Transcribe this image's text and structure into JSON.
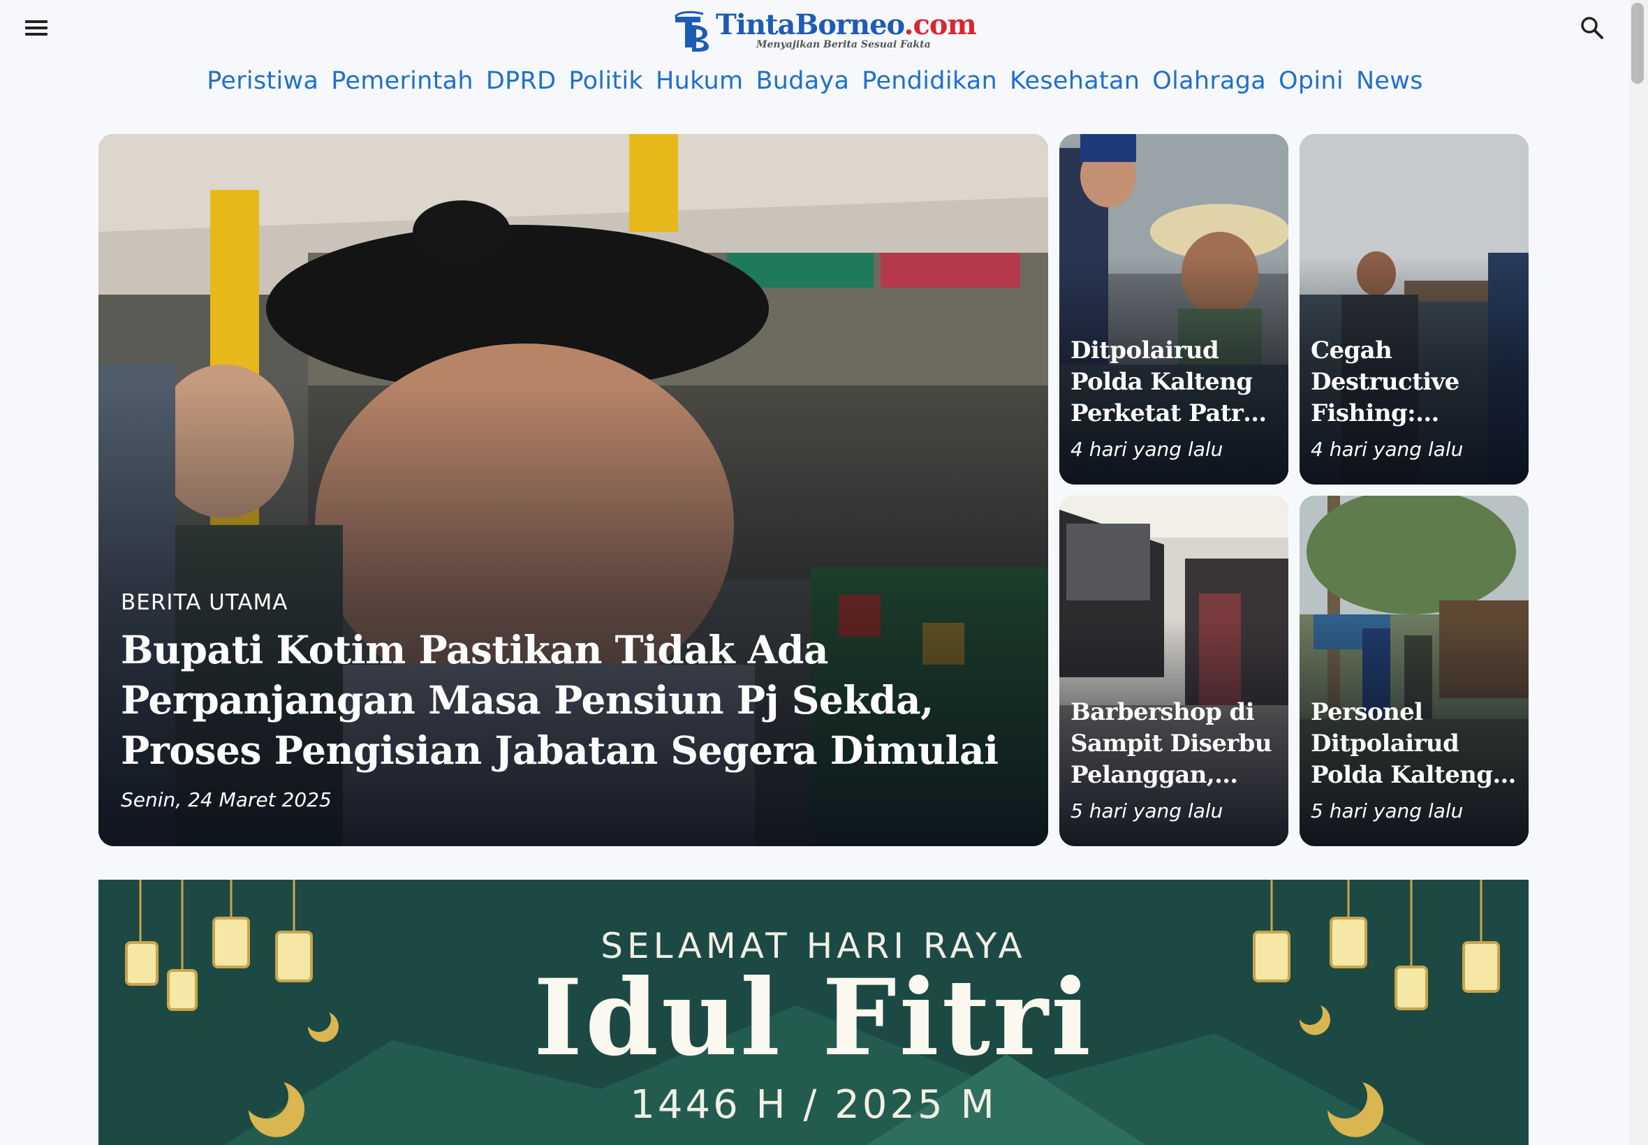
{
  "site": {
    "name": "TintaBorneo",
    "domain": ".com",
    "tagline": "Menyajikan Berita Sesuai Fakta"
  },
  "icons": {
    "menu": "hamburger-menu-icon",
    "search": "search-icon"
  },
  "colors": {
    "brand_blue": "#1e5bb5",
    "nav_blue": "#1e6fd0",
    "brand_red": "#d8282e"
  },
  "nav": [
    {
      "label": "Peristiwa"
    },
    {
      "label": "Pemerintah"
    },
    {
      "label": "DPRD"
    },
    {
      "label": "Politik"
    },
    {
      "label": "Hukum"
    },
    {
      "label": "Budaya"
    },
    {
      "label": "Pendidikan"
    },
    {
      "label": "Kesehatan"
    },
    {
      "label": "Olahraga"
    },
    {
      "label": "Opini"
    },
    {
      "label": "News"
    }
  ],
  "hero": {
    "kicker": "BERITA UTAMA",
    "title": "Bupati Kotim Pastikan Tidak Ada Perpanjangan Masa Pensiun Pj Sekda, Proses Pengisian Jabatan Segera Dimulai",
    "date": "Senin, 24 Maret 2025"
  },
  "cards": [
    {
      "title": "Ditpolairud Polda Kalteng Perketat Patroli di DAS...",
      "time": "4 hari yang lalu"
    },
    {
      "title": "Cegah Destructive Fishing:...",
      "time": "4 hari yang lalu"
    },
    {
      "title": "Barbershop di Sampit Diserbu Pelanggan, Buk...",
      "time": "5 hari yang lalu"
    },
    {
      "title": "Personel Ditpolairud Polda Kalteng Perket...",
      "time": "5 hari yang lalu"
    }
  ],
  "banner": {
    "subtitle": "SELAMAT HARI RAYA",
    "title": "Idul Fitri",
    "year": "1446 H / 2025 M"
  }
}
